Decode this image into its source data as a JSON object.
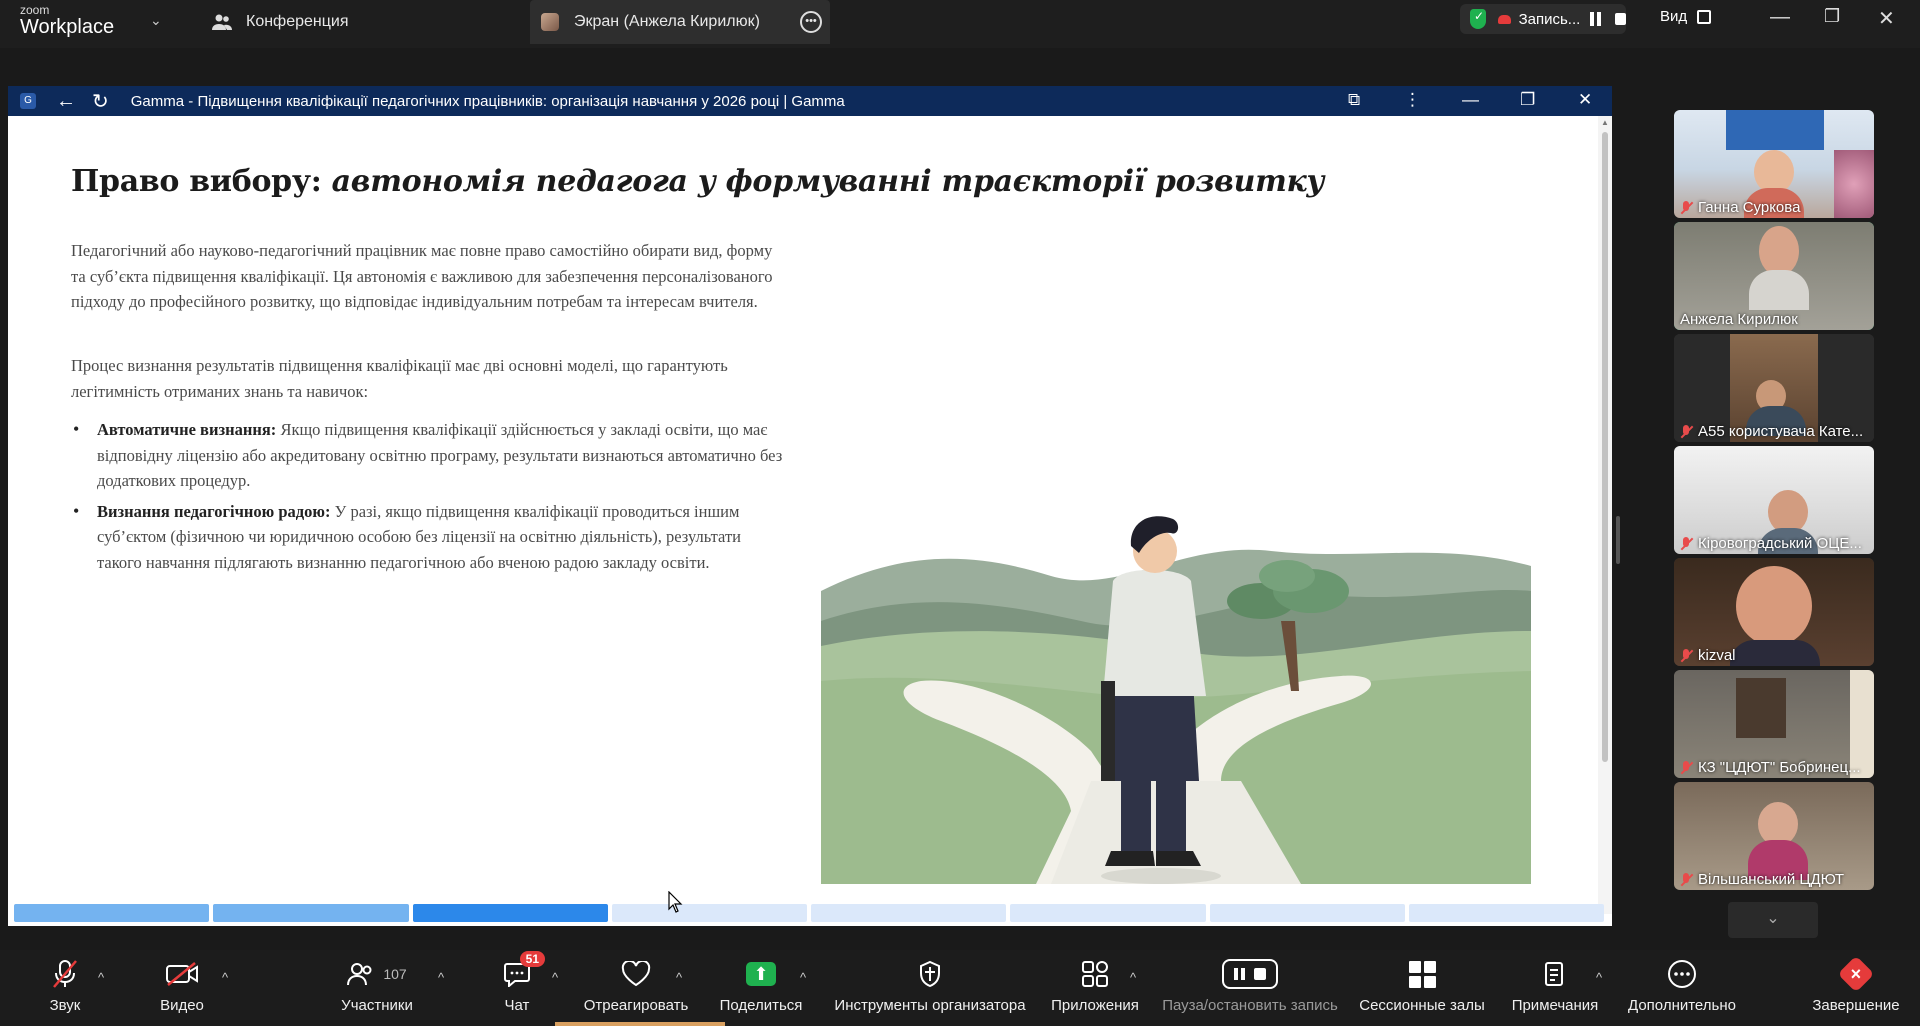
{
  "app": {
    "logo_top": "zoom",
    "logo_bottom": "Workplace"
  },
  "tabs": [
    {
      "label": "Конференция",
      "icon": "people-icon"
    },
    {
      "label": "Экран (Анжела Кирилюк)",
      "icon": "avatar"
    }
  ],
  "recording": {
    "label": "Запись...",
    "view_label": "Вид"
  },
  "browser": {
    "title": "Gamma - Підвищення кваліфікації педагогічних працівників: організація навчання у 2026 році | Gamma"
  },
  "slide": {
    "heading_plain": "Право вибору: ",
    "heading_italic": "автономія педагога у формуванні траєкторії розвитку",
    "paragraph1": "Педагогічний або науково-педагогічний працівник має повне право самостійно обирати вид, форму та суб’єкта підвищення кваліфікації. Ця автономія є важливою для забезпечення персоналізованого підходу до професійного розвитку, що відповідає індивідуальним потребам та інтересам вчителя.",
    "paragraph2": "Процес визнання результатів підвищення кваліфікації має дві основні моделі, що гарантують легітимність отриманих знань та навичок:",
    "bullets": [
      {
        "bold": "Автоматичне визнання:",
        "text": " Якщо підвищення кваліфікації здійснюється у закладі освіти, що має відповідну ліцензію або акредитовану освітню програму, результати визнаються автоматично без додаткових процедур."
      },
      {
        "bold": "Визнання педагогічною радою:",
        "text": " У разі, якщо підвищення кваліфікації проводиться іншим суб’єктом (фізичною чи юридичною особою без ліцензії на освітню діяльність), результати такого навчання підлягають визнанню педагогічною або вченою радою закладу освіти."
      }
    ],
    "progress": {
      "total_segments": 8,
      "current_segment": 3
    }
  },
  "participants_gallery": [
    {
      "name": "Ганна Суркова",
      "muted": true,
      "active": false
    },
    {
      "name": "Анжела Кирилюк",
      "muted": false,
      "active": true
    },
    {
      "name": "A55 користувача Кате...",
      "muted": true,
      "active": false
    },
    {
      "name": "Кіровоградський ОЦЕ...",
      "muted": true,
      "active": false
    },
    {
      "name": "kizval",
      "muted": true,
      "active": false
    },
    {
      "name": "КЗ \"ЦДЮТ\" Бобринец...",
      "muted": true,
      "active": false
    },
    {
      "name": "Вільшанський ЦДЮТ",
      "muted": true,
      "active": false
    }
  ],
  "toolbar": {
    "audio": "Звук",
    "video": "Видео",
    "participants": "Участники",
    "participants_count": "107",
    "chat": "Чат",
    "chat_badge": "51",
    "react": "Отреагировать",
    "share": "Поделиться",
    "host_tools": "Инструменты организатора",
    "apps": "Приложения",
    "pause_record": "Пауза/остановить запись",
    "breakout": "Сессионные залы",
    "notes": "Примечания",
    "more": "Дополнительно",
    "end": "Завершение"
  },
  "colors": {
    "active_border": "#23d18b",
    "end_red": "#e53b3b",
    "share_green": "#1fb14f",
    "browser_bar": "#0d2a5a",
    "progress_current": "#2c88ea"
  }
}
